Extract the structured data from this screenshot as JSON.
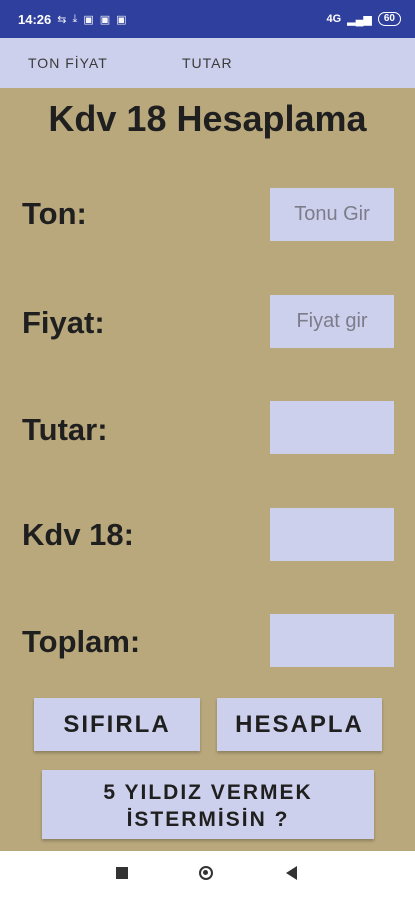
{
  "status_bar": {
    "time": "14:26",
    "icons": [
      "sync-icon",
      "download-icon",
      "notification-icon",
      "notification-icon",
      "notification-icon"
    ],
    "network": "4G",
    "battery": "60"
  },
  "tabs": [
    {
      "label": "TON FİYAT"
    },
    {
      "label": "TUTAR"
    }
  ],
  "title": "Kdv 18 Hesaplama",
  "form": {
    "ton_label": "Ton:",
    "ton_placeholder": "Tonu Gir",
    "fiyat_label": "Fiyat:",
    "fiyat_placeholder": "Fiyat gir",
    "tutar_label": "Tutar:",
    "kdv_label": "Kdv 18:",
    "toplam_label": "Toplam:"
  },
  "buttons": {
    "reset": "SIFIRLA",
    "calculate": "HESAPLA",
    "rate_line1": "5 YILDIZ VERMEK",
    "rate_line2": "İSTERMİSİN ?"
  },
  "colors": {
    "status_bar": "#2f3f9e",
    "background": "#b9a87c",
    "control": "#cdd0ec"
  }
}
